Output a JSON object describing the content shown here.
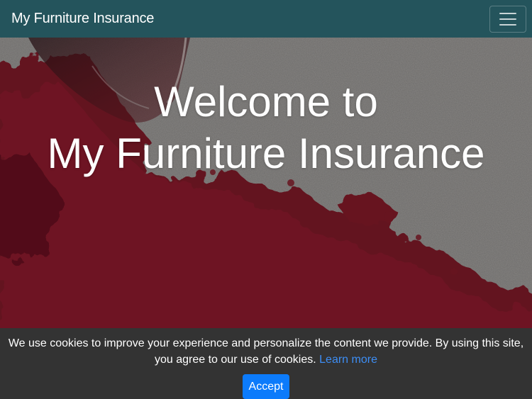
{
  "navbar": {
    "brand": "My Furniture Insurance",
    "menu_icon": "hamburger-menu-icon"
  },
  "hero": {
    "title_line1": "Welcome to",
    "title_line2": "My Furniture Insurance",
    "image_subject": "spilled-red-wine-on-carpet"
  },
  "cookie_banner": {
    "message": "We use cookies to improve your experience and personalize the content we provide. By using this site, you agree to our use of cookies.",
    "link_text": "Learn more",
    "accept_label": "Accept"
  },
  "colors": {
    "navbar_bg": "#24545c",
    "cookie_bg": "#333333",
    "accept_btn": "#0c7bfb",
    "link": "#3d8ef5"
  }
}
